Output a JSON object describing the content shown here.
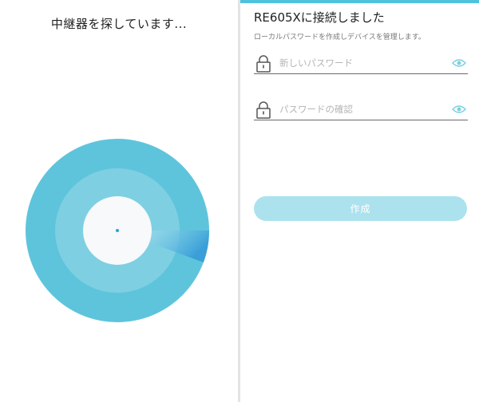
{
  "left_panel": {
    "title": "中継器を探しています..."
  },
  "right_panel": {
    "title": "RE605Xに接続しました",
    "subtitle": "ローカルパスワードを作成しデバイスを管理します。",
    "new_password": {
      "placeholder": "新しいパスワード",
      "value": "",
      "icon": "lock-icon",
      "toggle_icon": "eye-icon"
    },
    "confirm_password": {
      "placeholder": "パスワードの確認",
      "value": "",
      "icon": "lock-icon",
      "toggle_icon": "eye-icon"
    },
    "create_button_label": "作成"
  },
  "colors": {
    "accent": "#4fc3de",
    "radar_outer": "#5ec4dc",
    "radar_middle": "#7fcfe2",
    "radar_inner": "#f7f9fa",
    "radar_sweep": "#3a9fd8",
    "button_disabled": "#ace2ee",
    "eye_icon": "#7dd0df"
  }
}
